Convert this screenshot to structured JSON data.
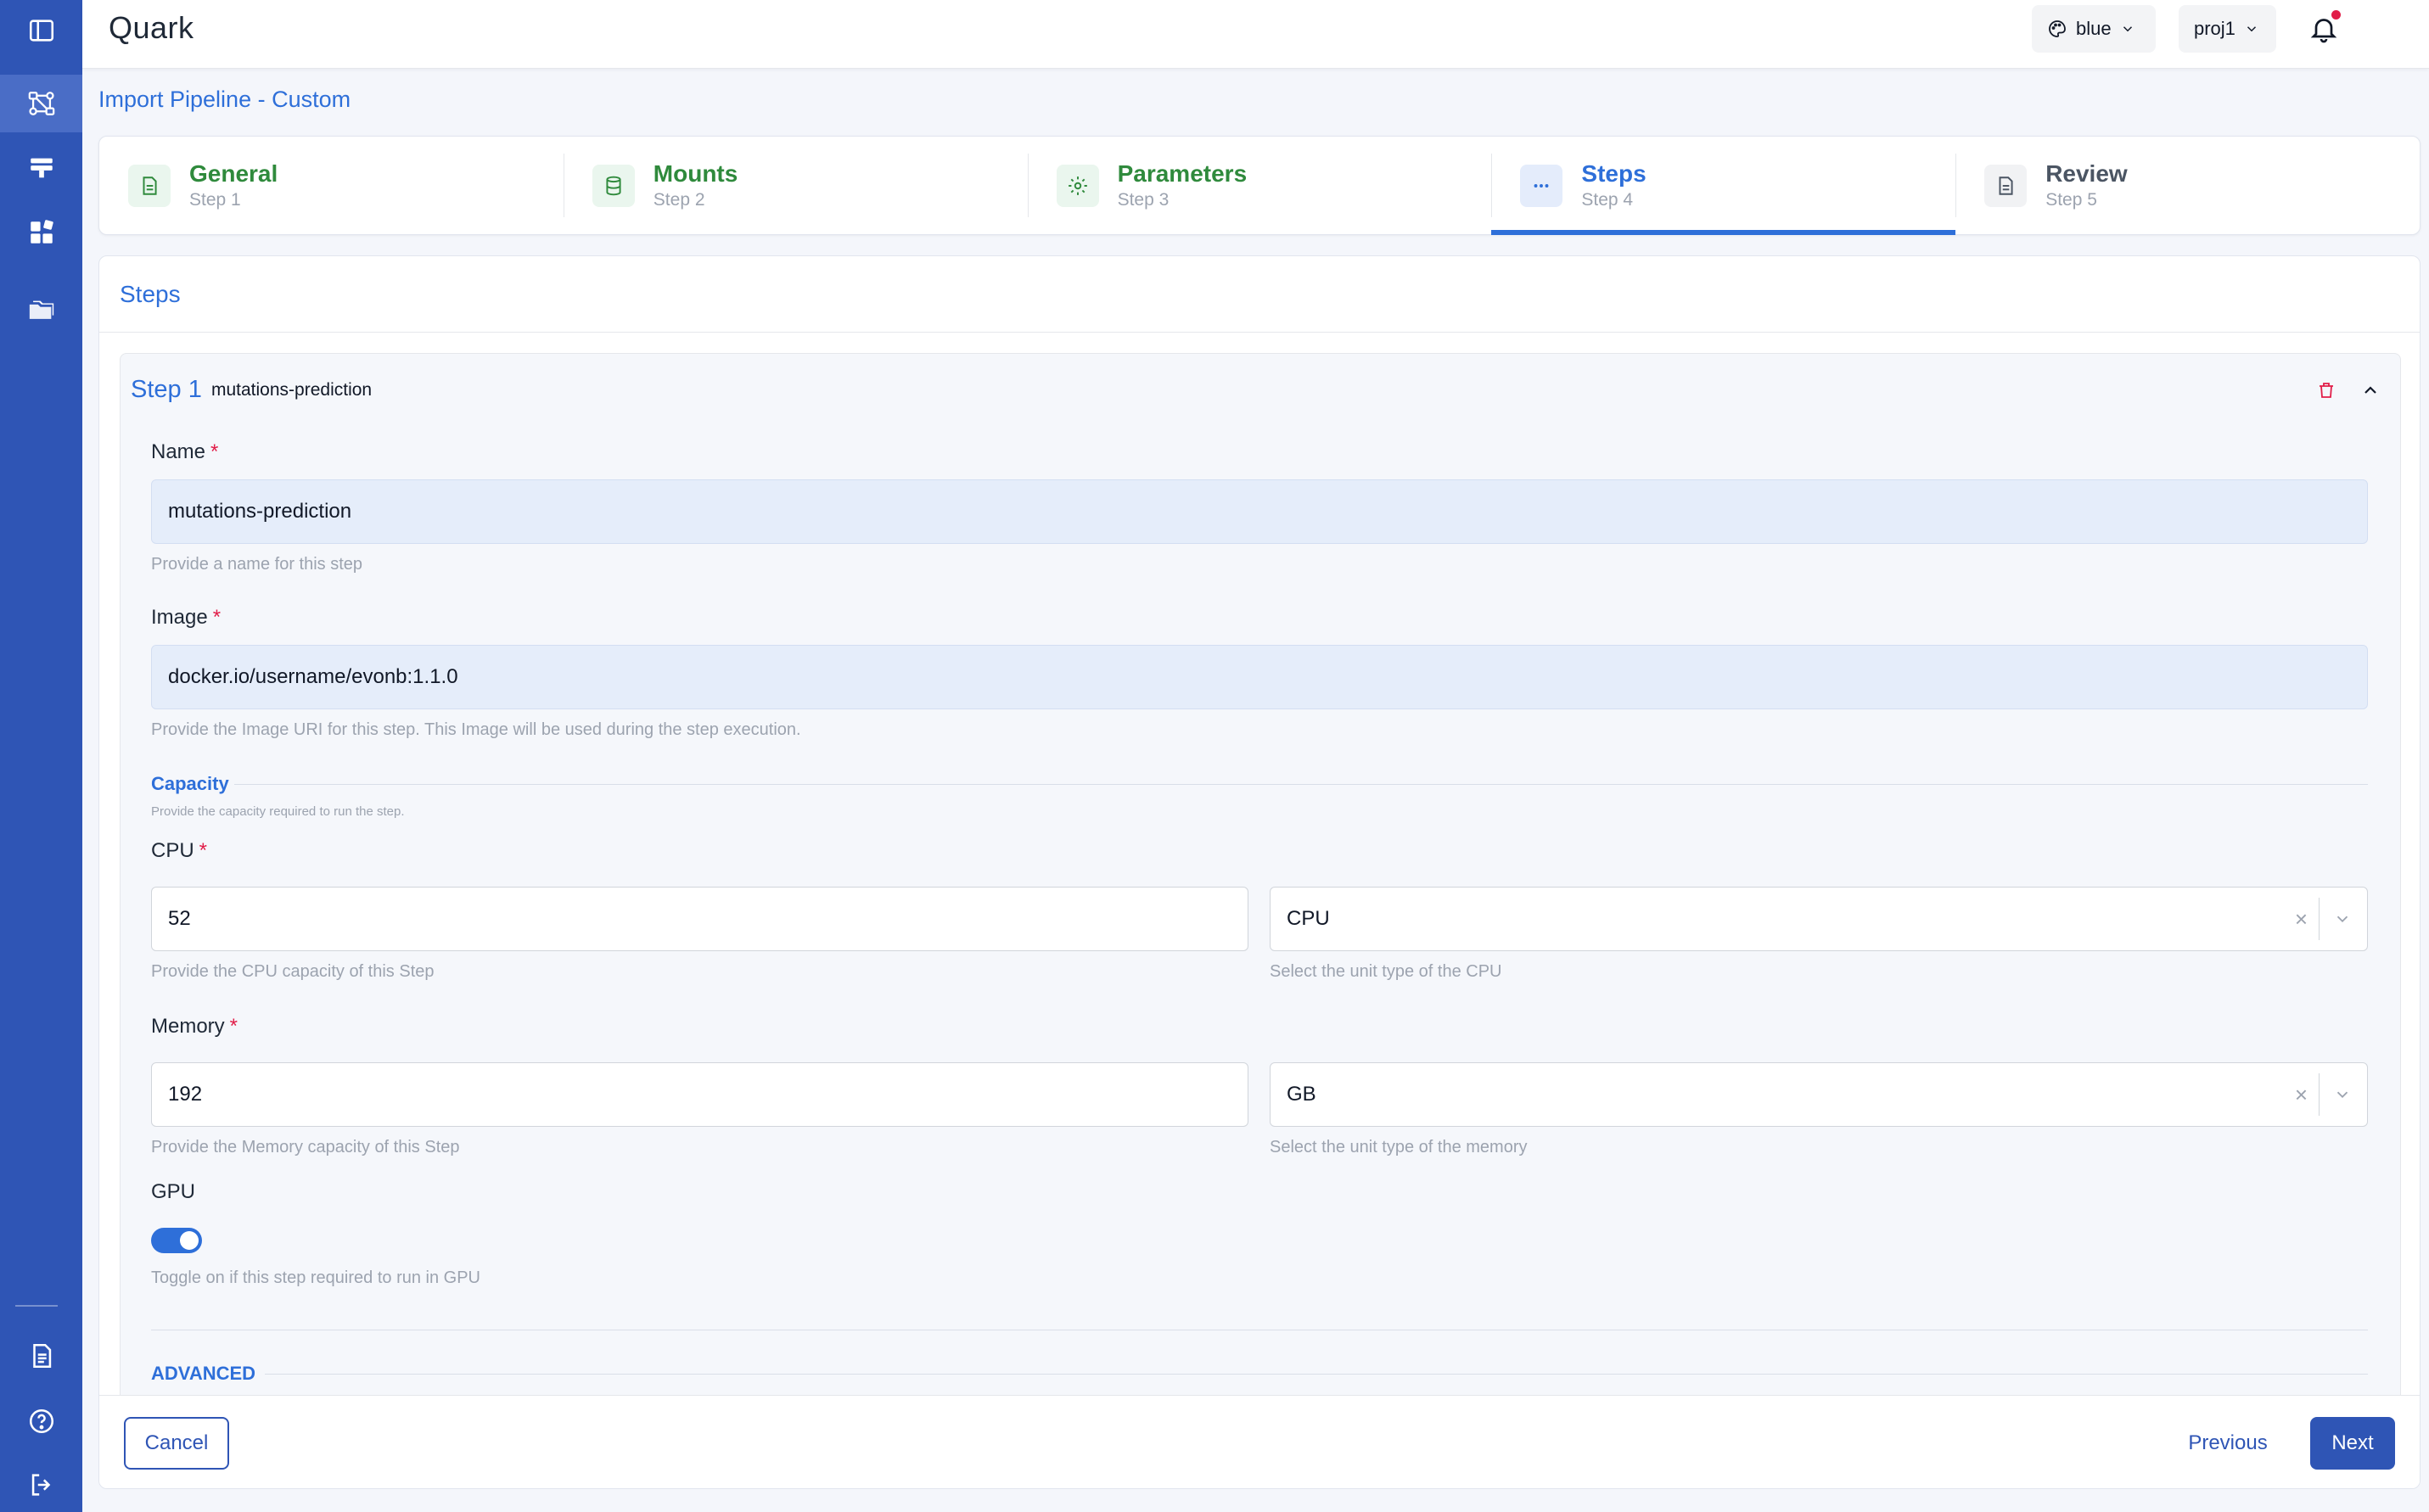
{
  "app": {
    "title": "Quark"
  },
  "header": {
    "theme": {
      "label": "blue",
      "icon": "palette-icon"
    },
    "project": {
      "label": "proj1"
    },
    "notifications": {
      "icon": "bell-icon",
      "has_unread": true
    },
    "user": {
      "icon": "user-icon"
    }
  },
  "sidebar": {
    "items": [
      {
        "icon": "panel-toggle-icon"
      },
      {
        "icon": "pipeline-icon",
        "active": true
      },
      {
        "icon": "server-icon"
      },
      {
        "icon": "apps-icon"
      },
      {
        "icon": "folders-icon"
      },
      {
        "icon": "document-icon"
      },
      {
        "icon": "help-icon"
      },
      {
        "icon": "logout-icon"
      }
    ]
  },
  "page": {
    "title": "Import Pipeline - Custom"
  },
  "stepper": {
    "steps": [
      {
        "title": "General",
        "subtitle": "Step 1",
        "state": "done",
        "icon": "file-icon"
      },
      {
        "title": "Mounts",
        "subtitle": "Step 2",
        "state": "done",
        "icon": "database-icon"
      },
      {
        "title": "Parameters",
        "subtitle": "Step 3",
        "state": "done",
        "icon": "gear-icon"
      },
      {
        "title": "Steps",
        "subtitle": "Step 4",
        "state": "current",
        "icon": "dots-icon"
      },
      {
        "title": "Review",
        "subtitle": "Step 5",
        "state": "pending",
        "icon": "file-icon"
      }
    ]
  },
  "steps_panel": {
    "title": "Steps",
    "step": {
      "number_label": "Step 1",
      "name_label": "mutations-prediction",
      "fields": {
        "name": {
          "label": "Name",
          "required": "*",
          "value": "mutations-prediction",
          "help": "Provide a name for this step"
        },
        "image": {
          "label": "Image",
          "required": "*",
          "value": "docker.io/username/evonb:1.1.0",
          "help": "Provide the Image URI for this step. This Image will be used during the step execution."
        },
        "capacity": {
          "title": "Capacity",
          "help": "Provide the capacity required to run the step."
        },
        "cpu": {
          "label": "CPU",
          "required": "*",
          "value": "52",
          "help": "Provide the CPU capacity of this Step",
          "unit_value": "CPU",
          "unit_help": "Select the unit type of the CPU"
        },
        "memory": {
          "label": "Memory",
          "required": "*",
          "value": "192",
          "help": "Provide the Memory capacity of this Step",
          "unit_value": "GB",
          "unit_help": "Select the unit type of the memory"
        },
        "gpu": {
          "label": "GPU",
          "enabled": true,
          "help": "Toggle on if this step required to run in GPU"
        },
        "advanced": {
          "title": "ADVANCED"
        }
      },
      "clear_glyph": "×"
    }
  },
  "footer": {
    "cancel_label": "Cancel",
    "previous_label": "Previous",
    "next_label": "Next"
  },
  "colors": {
    "primary": "#2e6fd9",
    "sidebar": "#2f55b5",
    "done": "#2f8a3c",
    "required": "#e11d48"
  }
}
